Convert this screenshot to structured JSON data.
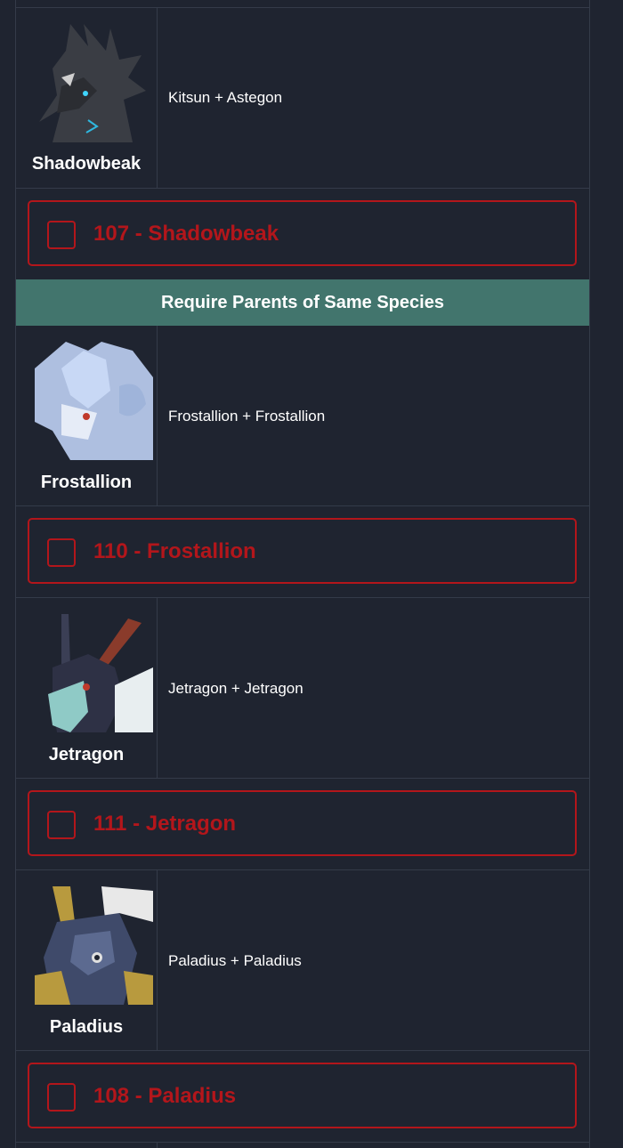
{
  "section_header": "Require Parents of Same Species",
  "entries": [
    {
      "name": "Shadowbeak",
      "parents": "Kitsun + Astegon",
      "checkbox_label": "107 - Shadowbeak",
      "icon": "shadowbeak-portrait"
    },
    {
      "name": "Frostallion",
      "parents": "Frostallion + Frostallion",
      "checkbox_label": "110 - Frostallion",
      "icon": "frostallion-portrait"
    },
    {
      "name": "Jetragon",
      "parents": "Jetragon + Jetragon",
      "checkbox_label": "111 - Jetragon",
      "icon": "jetragon-portrait"
    },
    {
      "name": "Paladius",
      "parents": "Paladius + Paladius",
      "checkbox_label": "108 - Paladius",
      "icon": "paladius-portrait"
    }
  ],
  "colors": {
    "background": "#1f2430",
    "border": "#343b49",
    "accent_red": "#b3161b",
    "header_teal": "#42756d"
  }
}
